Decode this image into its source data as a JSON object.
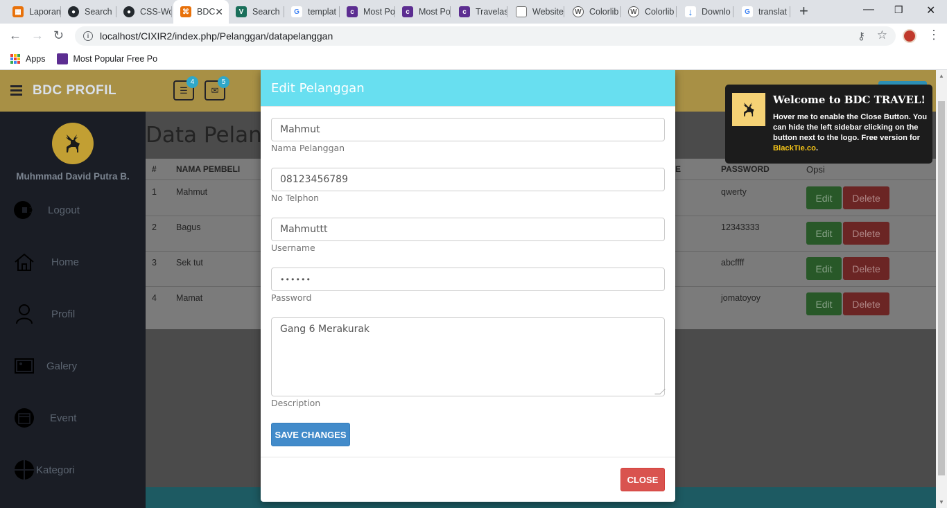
{
  "browser": {
    "tabs": [
      {
        "label": "Laporan",
        "color": "#e8710a",
        "glyph": "▦"
      },
      {
        "label": "Search",
        "color": "#24292e",
        "glyph": "◉"
      },
      {
        "label": "CSS-Wo",
        "color": "#24292e",
        "glyph": "◉"
      },
      {
        "label": "BDC",
        "color": "#e8710a",
        "glyph": "⌘"
      },
      {
        "label": "Search",
        "color": "#1a6f5a",
        "glyph": "V"
      },
      {
        "label": "templat",
        "color": "#4285f4",
        "glyph": "G"
      },
      {
        "label": "Most Po",
        "color": "#5c2d91",
        "glyph": "c"
      },
      {
        "label": "Most Po",
        "color": "#5c2d91",
        "glyph": "c"
      },
      {
        "label": "Travelas",
        "color": "#5c2d91",
        "glyph": "c"
      },
      {
        "label": "Website",
        "color": "#888888",
        "glyph": "▯"
      },
      {
        "label": "Colorlib",
        "color": "#555555",
        "glyph": "W"
      },
      {
        "label": "Colorlib",
        "color": "#555555",
        "glyph": "W"
      },
      {
        "label": "Downlo",
        "color": "#1a73e8",
        "glyph": "↓"
      },
      {
        "label": "translat",
        "color": "#4285f4",
        "glyph": "G"
      }
    ],
    "url": "localhost/CIXIR2/index.php/Pelanggan/datapelanggan",
    "bookmarks": {
      "apps": "Apps",
      "item": "Most Popular Free Po"
    }
  },
  "header": {
    "brand": "BDC PROFIL",
    "notif_tasks": "4",
    "notif_mail": "5"
  },
  "sidebar": {
    "username": "Muhmmad David Putra B.",
    "items": [
      {
        "label": "Logout",
        "icon": "logout-icon"
      },
      {
        "label": "Home",
        "icon": "home-icon"
      },
      {
        "label": "Profil",
        "icon": "user-icon"
      },
      {
        "label": "Galery",
        "icon": "image-icon"
      },
      {
        "label": "Event",
        "icon": "calendar-icon"
      },
      {
        "label": "Kategori",
        "icon": "pie-icon"
      }
    ]
  },
  "main": {
    "title": "Data Pelanggan",
    "columns": [
      "#",
      "NAMA PEMBELI",
      "E",
      "PASSWORD",
      "Opsi"
    ],
    "rows": [
      {
        "no": "1",
        "name": "Mahmut",
        "password": "qwerty"
      },
      {
        "no": "2",
        "name": "Bagus",
        "password": "12343333"
      },
      {
        "no": "3",
        "name": "Sek tut",
        "password": "abcffff"
      },
      {
        "no": "4",
        "name": "Mamat",
        "password": "jomatoyoy"
      }
    ],
    "edit_label": "Edit",
    "delete_label": "Delete"
  },
  "modal": {
    "title": "Edit Pelanggan",
    "fields": {
      "nama": {
        "value": "Mahmut",
        "help": "Nama Pelanggan"
      },
      "telp": {
        "value": "08123456789",
        "help": "No Telphon"
      },
      "username": {
        "value": "Mahmuttt",
        "help": "Username"
      },
      "password": {
        "value": "••••••",
        "help": "Password"
      },
      "description": {
        "value": "Gang 6 Merakurak",
        "help": "Description"
      }
    },
    "save_label": "SAVE CHANGES",
    "close_label": "CLOSE"
  },
  "toast": {
    "title": "Welcome to BDC TRAVEL!",
    "text": "Hover me to enable the Close Button. You can hide the left sidebar clicking on the button next to the logo. Free version for ",
    "link": "BlackTie.co",
    "end": "."
  }
}
